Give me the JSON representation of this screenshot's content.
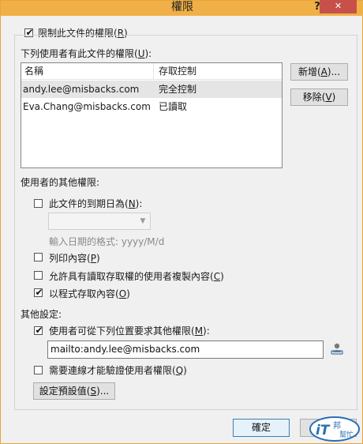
{
  "window": {
    "title": "權限",
    "help": "?",
    "close": "✕"
  },
  "restrict": {
    "label": "限制此文件的權限(",
    "key": "R",
    "tail": ")",
    "checked": true
  },
  "users_section": {
    "label": "下列使用者有此文件的權限(",
    "key": "U",
    "tail": "):",
    "columns": [
      "名稱",
      "存取控制"
    ],
    "rows": [
      {
        "name": "andy.lee@misbacks.com",
        "access": "完全控制",
        "selected": true
      },
      {
        "name": "Eva.Chang@misbacks.com",
        "access": "已讀取",
        "selected": false
      }
    ]
  },
  "buttons": {
    "add": {
      "label": "新增(",
      "key": "A",
      "tail": ")..."
    },
    "remove": {
      "label": "移除(",
      "key": "V",
      "tail": ")"
    },
    "defaults": {
      "label": "設定預設值(",
      "key": "S",
      "tail": ")..."
    },
    "ok": "確定",
    "cancel": "取消"
  },
  "other_permissions": {
    "header": "使用者的其他權限:",
    "expires": {
      "label": "此文件的到期日為(",
      "key": "N",
      "tail": "):",
      "checked": false
    },
    "date_hint": "輸入日期的格式: yyyy/M/d",
    "print": {
      "label": "列印內容(",
      "key": "P",
      "tail": ")",
      "checked": false
    },
    "copy": {
      "label": "允許具有讀取存取權的使用者複製內容(",
      "key": "C",
      "tail": ")",
      "checked": false
    },
    "programmatic": {
      "label": "以程式存取內容(",
      "key": "O",
      "tail": ")",
      "checked": true
    }
  },
  "other_settings": {
    "header": "其他設定:",
    "request": {
      "label": "使用者可從下列位置要求其他權限(",
      "key": "M",
      "tail": "):",
      "checked": true
    },
    "request_value": "mailto:andy.lee@misbacks.com",
    "connect": {
      "label": "需要連線才能驗證使用者權限(",
      "key": "Q",
      "tail": ")",
      "checked": false
    }
  },
  "watermark_text": "iT邦幫忙"
}
